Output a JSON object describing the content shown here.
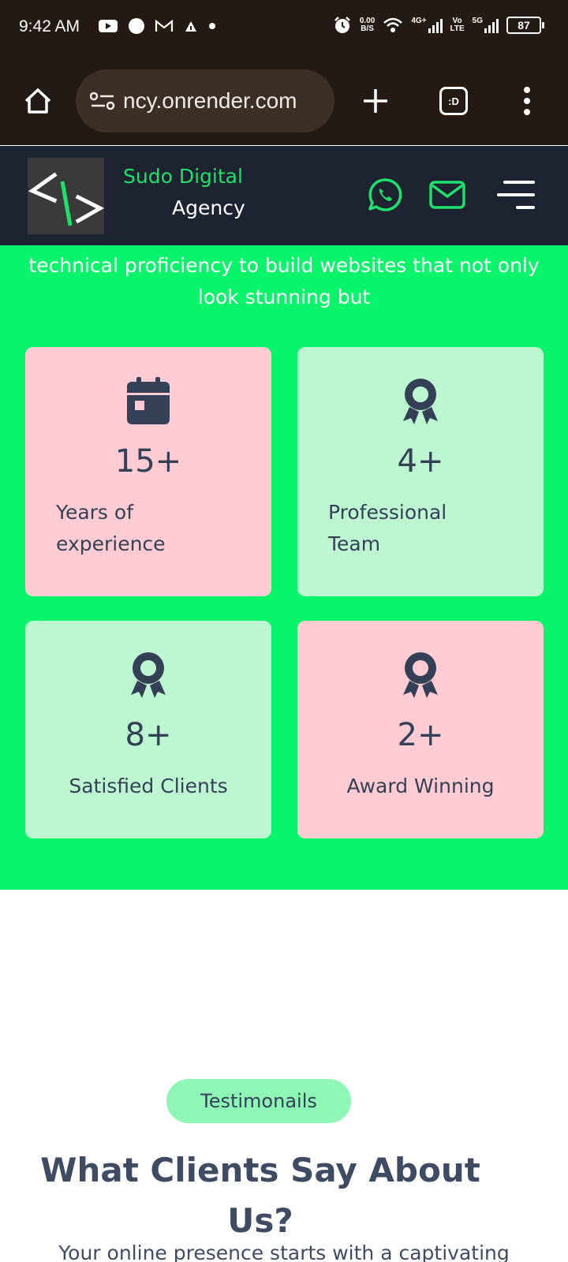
{
  "status_bar": {
    "time": "9:42 AM",
    "net_speed_value": "0.00",
    "net_speed_unit": "B/S",
    "network1": "4G+",
    "volte_top": "Vo",
    "volte_bottom": "LTE",
    "network2": "5G",
    "battery": "87"
  },
  "browser": {
    "url": "ncy.onrender.com",
    "tab_label": ":D"
  },
  "header": {
    "brand_line1": "Sudo Digital",
    "brand_line2": "Agency",
    "accent_color": "#1ee06a",
    "bg_color": "#1d2330"
  },
  "intro": {
    "text": "website. Our developers blend creativity with technical proficiency to build websites that not only look stunning but"
  },
  "stats": [
    {
      "value": "15+",
      "label": "Years of experience",
      "icon": "calendar-icon",
      "bg": "#ffccd3"
    },
    {
      "value": "4+",
      "label": "Professional Team",
      "icon": "award-icon",
      "bg": "#bcf7d2"
    },
    {
      "value": "8+",
      "label": "Satisfied Clients",
      "icon": "award-icon",
      "bg": "#bcf7d2"
    },
    {
      "value": "2+",
      "label": "Award Winning",
      "icon": "award-icon",
      "bg": "#ffccd3"
    }
  ],
  "testimonials": {
    "badge": "Testimonails",
    "title": "What Clients Say About Us?",
    "subtitle": "Your online presence starts with a captivating"
  },
  "colors": {
    "section_green": "#08f56b",
    "text_dark": "#344055"
  }
}
